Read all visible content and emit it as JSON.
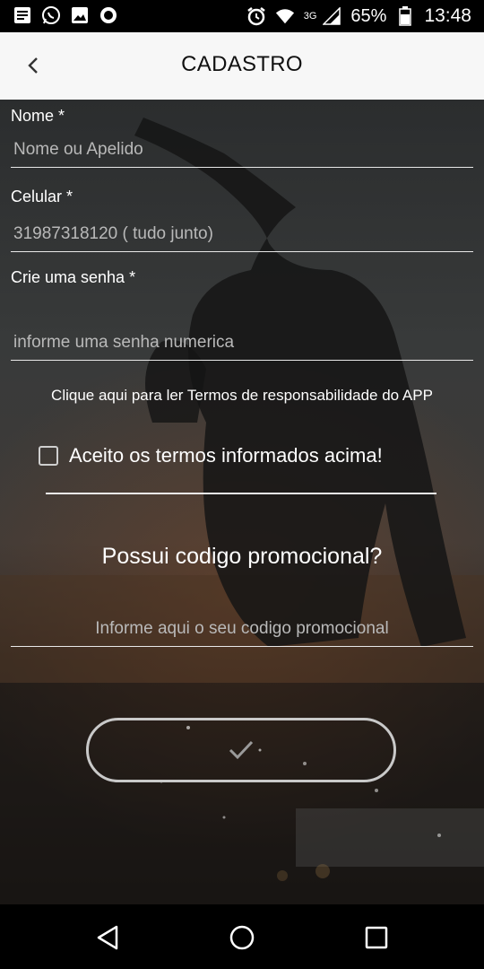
{
  "status_bar": {
    "network": "3G",
    "battery": "65%",
    "time": "13:48",
    "left_icons": [
      "notes-icon",
      "whatsapp-icon",
      "image-icon",
      "record-icon"
    ],
    "right_icons": [
      "alarm-icon",
      "wifi-icon",
      "signal-icon",
      "battery-icon"
    ]
  },
  "app_bar": {
    "title": "CADASTRO",
    "back_icon": "chevron-left-icon"
  },
  "form": {
    "name": {
      "label": "Nome *",
      "placeholder": "Nome ou Apelido",
      "value": ""
    },
    "phone": {
      "label": "Celular *",
      "placeholder": "31987318120 ( tudo junto)",
      "value": ""
    },
    "password": {
      "label": "Crie uma senha *",
      "placeholder": "informe uma senha numerica",
      "value": ""
    },
    "terms_link": "Clique aqui para ler Termos de responsabilidade do APP",
    "accept_label": "Aceito os termos informados acima!",
    "accept_checked": false,
    "promo_title": "Possui codigo promocional?",
    "promo": {
      "placeholder": "Informe aqui o seu codigo promocional",
      "value": ""
    },
    "submit_icon": "check-icon"
  },
  "nav_bar": {
    "buttons": [
      "back-triangle-icon",
      "home-circle-icon",
      "recents-square-icon"
    ]
  }
}
